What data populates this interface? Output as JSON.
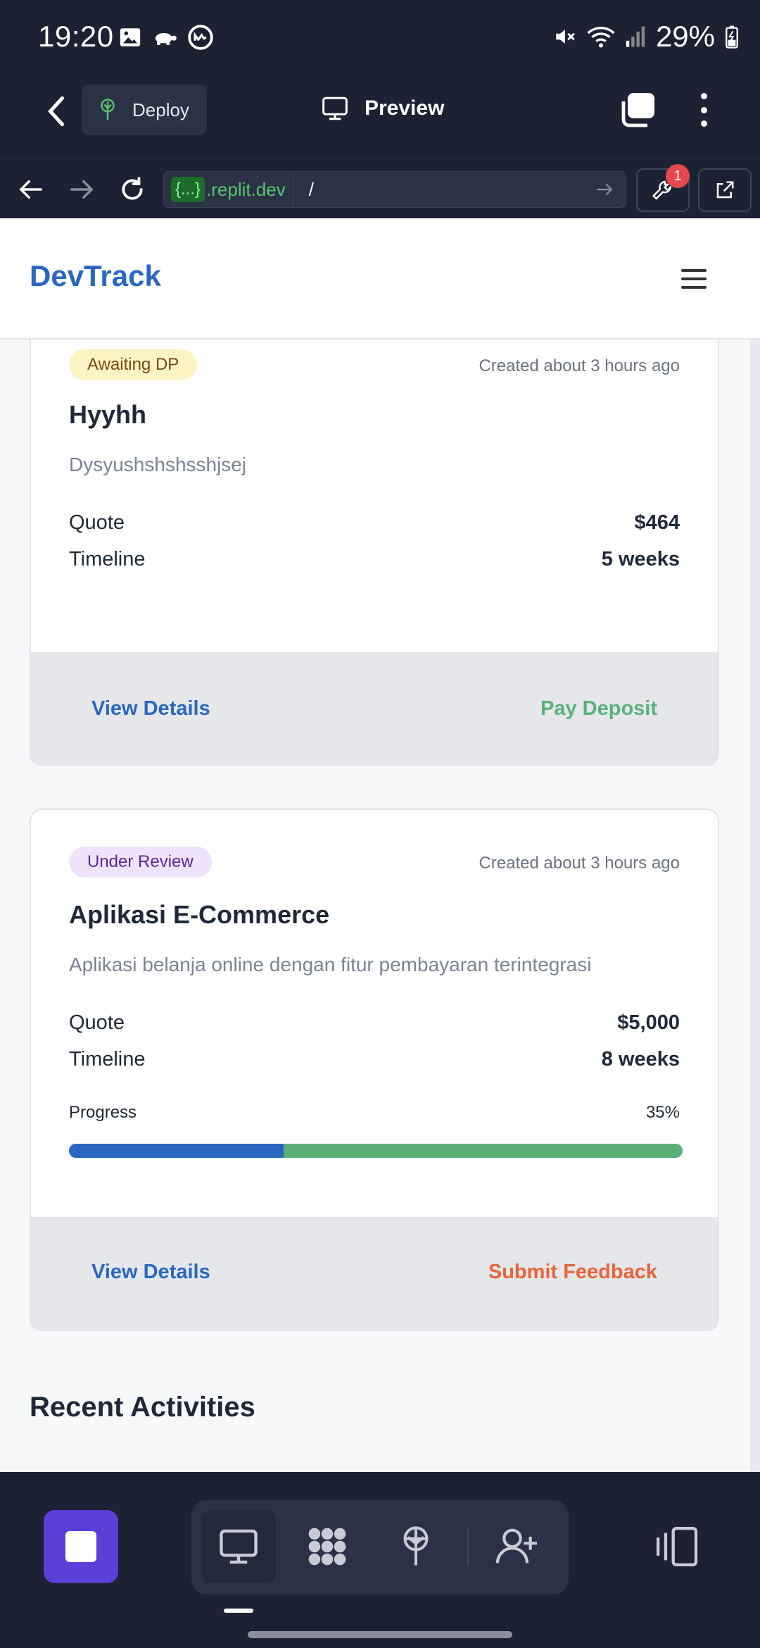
{
  "status_bar": {
    "time": "19:20",
    "battery": "29%"
  },
  "toolbar": {
    "deploy_label": "Deploy",
    "preview_label": "Preview"
  },
  "address_bar": {
    "domain_prefix": "{...}",
    "domain": ".replit.dev",
    "path": "/",
    "notification_count": "1"
  },
  "site": {
    "brand": "DevTrack"
  },
  "projects": [
    {
      "status": "Awaiting DP",
      "created": "Created about 3 hours ago",
      "title": "Hyyhh",
      "description": "Dysyushshshsshjsej",
      "quote_label": "Quote",
      "quote": "$464",
      "timeline_label": "Timeline",
      "timeline": "5 weeks",
      "primary_action": "View Details",
      "secondary_action": "Pay Deposit"
    },
    {
      "status": "Under Review",
      "created": "Created about 3 hours ago",
      "title": "Aplikasi E-Commerce",
      "description": "Aplikasi belanja online dengan fitur pembayaran terintegrasi",
      "quote_label": "Quote",
      "quote": "$5,000",
      "timeline_label": "Timeline",
      "timeline": "8 weeks",
      "progress_label": "Progress",
      "progress_text": "35%",
      "progress_value": 0.35,
      "primary_action": "View Details",
      "secondary_action": "Submit Feedback"
    }
  ],
  "recent_activities_title": "Recent Activities",
  "colors": {
    "brand": "#2b67c0",
    "awaiting_pill_bg": "#fdf3c4",
    "awaiting_pill_text": "#7a4a12",
    "review_pill_bg": "#efe3fb",
    "review_pill_text": "#5b2a96",
    "pay_deposit": "#5bb07a",
    "submit_feedback": "#e8643a",
    "progress_fill": "#2b67c0",
    "progress_track": "#5bb07a"
  }
}
